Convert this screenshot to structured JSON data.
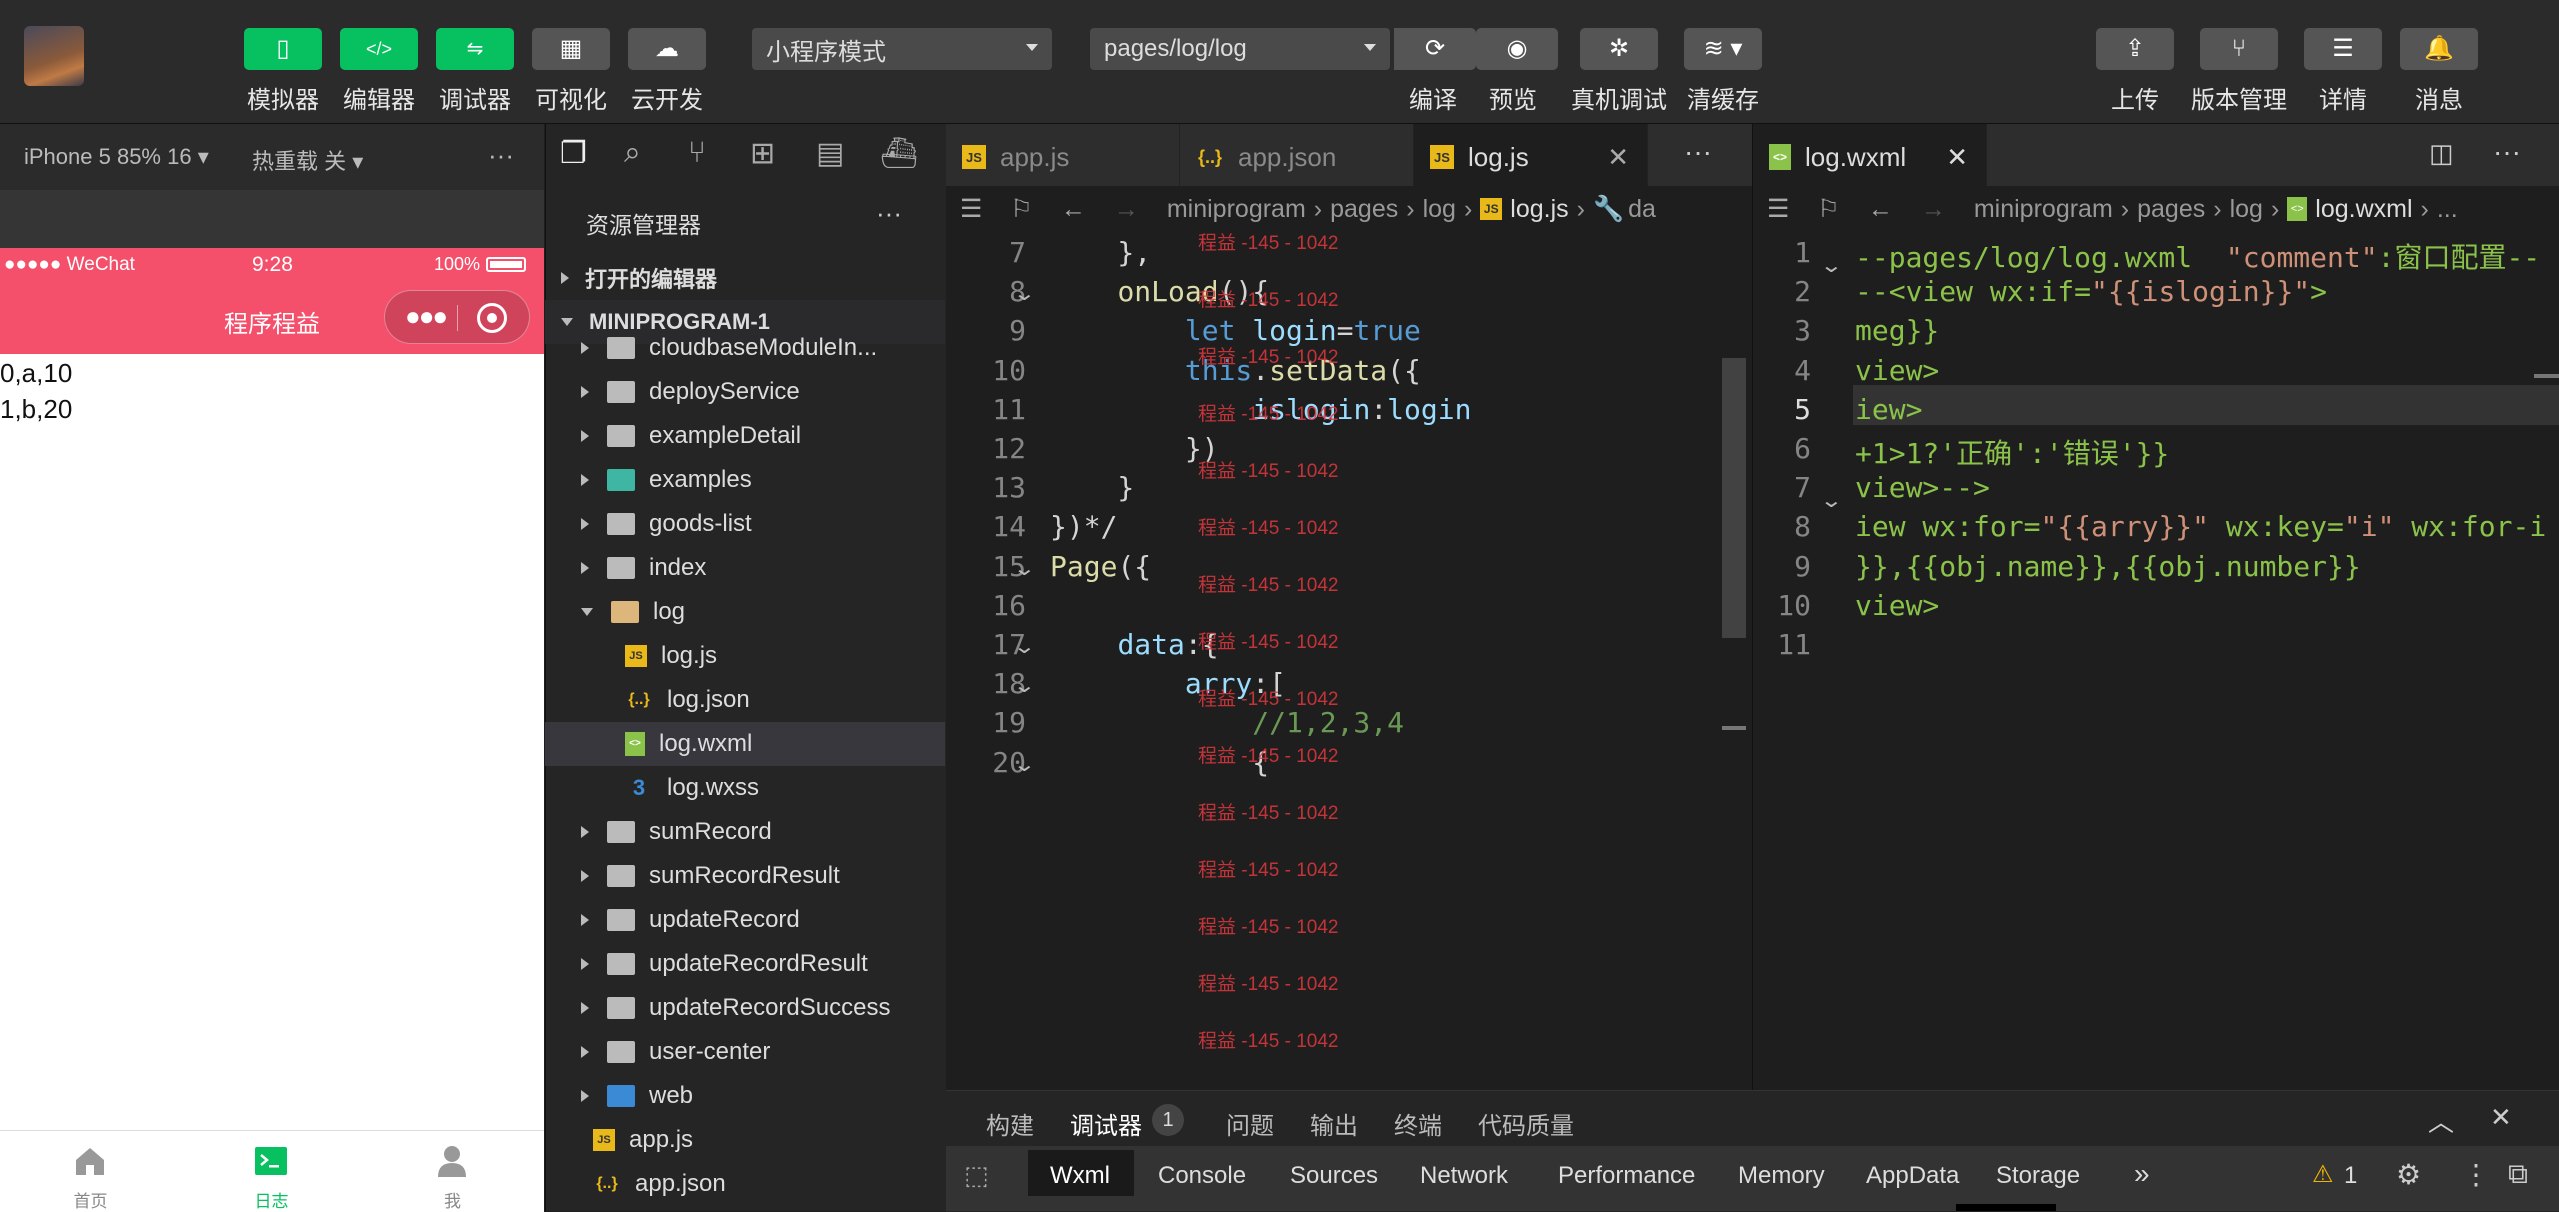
{
  "toolbar": {
    "left_buttons": [
      {
        "label": "模拟器",
        "icon": "phone-icon"
      },
      {
        "label": "编辑器",
        "icon": "code-icon"
      },
      {
        "label": "调试器",
        "icon": "debug-icon"
      },
      {
        "label": "可视化",
        "icon": "layout-icon"
      },
      {
        "label": "云开发",
        "icon": "cloud-icon"
      }
    ],
    "mode_select": "小程序模式",
    "page_select": "pages/log/log",
    "mid_buttons": [
      {
        "label": "编译",
        "icon": "refresh-icon"
      },
      {
        "label": "预览",
        "icon": "eye-icon"
      },
      {
        "label": "真机调试",
        "icon": "bug-icon"
      },
      {
        "label": "清缓存",
        "icon": "layers-icon"
      }
    ],
    "right_buttons": [
      {
        "label": "上传",
        "icon": "upload-icon"
      },
      {
        "label": "版本管理",
        "icon": "branch-icon"
      },
      {
        "label": "详情",
        "icon": "menu-icon"
      },
      {
        "label": "消息",
        "icon": "bell-icon"
      }
    ]
  },
  "simulator": {
    "device": "iPhone 5 85% 16",
    "hot_reload": "热重载 关",
    "more": "···",
    "status": {
      "carrier": "●●●●● WeChat",
      "time": "9:28",
      "battery": "100%"
    },
    "nav_title": "程序程益",
    "body_lines": [
      "0,a,10",
      "1,b,20"
    ],
    "tabs": [
      {
        "label": "首页"
      },
      {
        "label": "日志"
      },
      {
        "label": "我"
      }
    ]
  },
  "explorer": {
    "title": "资源管理器",
    "more": "···",
    "open_editors": "打开的编辑器",
    "project": "MINIPROGRAM-1",
    "items": [
      {
        "name": "cloudbaseModuleIn...",
        "type": "folder",
        "depth": 1
      },
      {
        "name": "deployService",
        "type": "folder",
        "depth": 1
      },
      {
        "name": "exampleDetail",
        "type": "folder",
        "depth": 1
      },
      {
        "name": "examples",
        "type": "folder-special",
        "depth": 1
      },
      {
        "name": "goods-list",
        "type": "folder",
        "depth": 1
      },
      {
        "name": "index",
        "type": "folder",
        "depth": 1
      },
      {
        "name": "log",
        "type": "folder-open",
        "depth": 1
      },
      {
        "name": "log.js",
        "type": "js",
        "depth": 2
      },
      {
        "name": "log.json",
        "type": "json",
        "depth": 2
      },
      {
        "name": "log.wxml",
        "type": "wxml",
        "depth": 2,
        "selected": true
      },
      {
        "name": "log.wxss",
        "type": "wxss",
        "depth": 2
      },
      {
        "name": "sumRecord",
        "type": "folder",
        "depth": 1
      },
      {
        "name": "sumRecordResult",
        "type": "folder",
        "depth": 1
      },
      {
        "name": "updateRecord",
        "type": "folder",
        "depth": 1
      },
      {
        "name": "updateRecordResult",
        "type": "folder",
        "depth": 1
      },
      {
        "name": "updateRecordSuccess",
        "type": "folder",
        "depth": 1
      },
      {
        "name": "user-center",
        "type": "folder",
        "depth": 1
      },
      {
        "name": "web",
        "type": "folder-web",
        "depth": 1
      },
      {
        "name": "app.js",
        "type": "js",
        "depth": 0
      },
      {
        "name": "app.json",
        "type": "json",
        "depth": 0
      }
    ]
  },
  "editor_left": {
    "tabs": [
      {
        "label": "app.js",
        "icon": "JS"
      },
      {
        "label": "app.json",
        "icon": "{..}"
      },
      {
        "label": "log.js",
        "icon": "JS",
        "active": true
      }
    ],
    "more": "···",
    "breadcrumb": [
      "miniprogram",
      "pages",
      "log",
      "log.js",
      "da"
    ],
    "lines": [
      {
        "n": "7",
        "text": "    },"
      },
      {
        "n": "8",
        "text": "    onLoad(){"
      },
      {
        "n": "9",
        "text": "        let login=true"
      },
      {
        "n": "10",
        "text": "        this.setData({"
      },
      {
        "n": "11",
        "text": "            islogin:login"
      },
      {
        "n": "12",
        "text": "        })"
      },
      {
        "n": "13",
        "text": "    }"
      },
      {
        "n": "14",
        "text": "})*/"
      },
      {
        "n": "15",
        "text": "Page({"
      },
      {
        "n": "16",
        "text": ""
      },
      {
        "n": "17",
        "text": "    data:{"
      },
      {
        "n": "18",
        "text": "        arry:["
      },
      {
        "n": "19",
        "text": "            //1,2,3,4"
      },
      {
        "n": "20",
        "text": "            {"
      }
    ],
    "watermark": "程益 -145 - 1042"
  },
  "editor_right": {
    "tabs": [
      {
        "label": "log.wxml",
        "icon": "<>",
        "active": true
      }
    ],
    "more": "···",
    "breadcrumb": [
      "miniprogram",
      "pages",
      "log",
      "log.wxml",
      "..."
    ],
    "lines": [
      {
        "n": "1",
        "text": "--pages/log/log.wxml  \"comment\":窗口配置--"
      },
      {
        "n": "2",
        "text": "--<view wx:if=\"{{islogin}}\">"
      },
      {
        "n": "3",
        "text": "meg}}"
      },
      {
        "n": "4",
        "text": "view>"
      },
      {
        "n": "5",
        "text": "iew>"
      },
      {
        "n": "6",
        "text": "+1>1?'正确':'错误'}}"
      },
      {
        "n": "7",
        "text": "view>-->"
      },
      {
        "n": "8",
        "text": "iew wx:for=\"{{arry}}\" wx:key=\"i\" wx:for-i"
      },
      {
        "n": "9",
        "text": "}},{{obj.name}},{{obj.number}}"
      },
      {
        "n": "10",
        "text": "view>"
      },
      {
        "n": "11",
        "text": ""
      }
    ]
  },
  "panel": {
    "tabs": [
      "构建",
      "调试器",
      "问题",
      "输出",
      "终端",
      "代码质量"
    ],
    "badge": "1",
    "devtools_tabs": [
      "Wxml",
      "Console",
      "Sources",
      "Network",
      "Performance",
      "Memory",
      "AppData",
      "Storage",
      "»"
    ],
    "warnings": "1"
  }
}
